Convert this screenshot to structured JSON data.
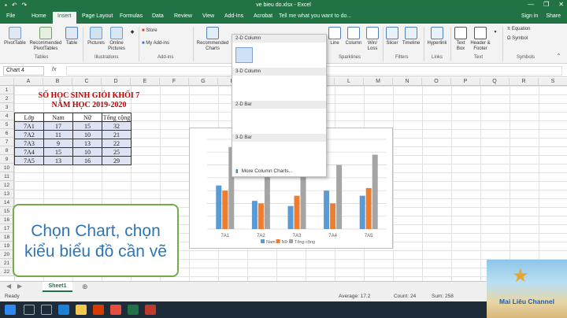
{
  "window": {
    "title": "ve bieu do.xlsx - Excel",
    "minimize": "—",
    "restore": "❐",
    "close": "✕"
  },
  "tabs": [
    "File",
    "Home",
    "Insert",
    "Page Layout",
    "Formulas",
    "Data",
    "Review",
    "View",
    "Add-Ins",
    "Acrobat"
  ],
  "tellme": "Tell me what you want to do...",
  "rightlinks": {
    "signin": "Sign in",
    "share": "Share"
  },
  "ribbon": {
    "tables": {
      "pivot": "PivotTable",
      "recommended": "Recommended PivotTables",
      "table": "Table",
      "group": "Tables"
    },
    "illustrations": {
      "pictures": "Pictures",
      "online": "Online Pictures",
      "group": "Illustrations"
    },
    "addins": {
      "store": "Store",
      "myaddins": "My Add-ins",
      "group": "Add-ins"
    },
    "charts": {
      "recommended": "Recommended Charts"
    },
    "sparklines": {
      "line": "Line",
      "column": "Column",
      "winloss": "Win/ Loss",
      "group": "Sparklines"
    },
    "filters": {
      "slicer": "Slicer",
      "timeline": "Timeline",
      "group": "Filters"
    },
    "links": {
      "hyperlink": "Hyperlink",
      "group": "Links"
    },
    "text": {
      "textbox": "Text Box",
      "header": "Header & Footer",
      "group": "Text"
    },
    "symbols": {
      "equation": "Equation",
      "symbol": "Symbol",
      "group": "Symbols"
    }
  },
  "namebox": "Chart 4",
  "fx": "fx",
  "columns": [
    "A",
    "B",
    "C",
    "D",
    "E",
    "F",
    "G",
    "H",
    "I",
    "J",
    "K",
    "L",
    "M",
    "N",
    "O",
    "P",
    "Q",
    "R",
    "S"
  ],
  "rows": [
    "1",
    "2",
    "3",
    "4",
    "5",
    "6",
    "7",
    "8",
    "9",
    "10",
    "11",
    "12",
    "13",
    "14",
    "15",
    "16",
    "17",
    "18",
    "19",
    "20",
    "21",
    "22"
  ],
  "sheet_title_1": "SỐ HỌC SINH GIỎI KHỐI 7",
  "sheet_title_2": "NĂM HỌC 2019-2020",
  "table": {
    "headers": [
      "Lớp",
      "Nam",
      "Nữ",
      "Tổng cộng"
    ],
    "rows": [
      [
        "7A1",
        "17",
        "15",
        "32"
      ],
      [
        "7A2",
        "11",
        "10",
        "21"
      ],
      [
        "7A3",
        "9",
        "13",
        "22"
      ],
      [
        "7A4",
        "15",
        "10",
        "25"
      ],
      [
        "7A5",
        "13",
        "16",
        "29"
      ]
    ]
  },
  "dropdown": {
    "h2dcol": "2-D Column",
    "h3dcol": "3-D Column",
    "h2dbar": "2-D Bar",
    "h3dbar": "3-D Bar",
    "more": "More Column Charts..."
  },
  "callout": {
    "line1": "Chọn Chart, chọn",
    "line2": "kiểu biểu đồ cần vẽ"
  },
  "sheet_tab": "Sheet1",
  "add_sheet": "⊕",
  "status": {
    "ready": "Ready",
    "average": "Average: 17.2",
    "count": "Count: 24",
    "sum": "Sum: 258"
  },
  "channel": "Mai Liêu Channel",
  "colors": {
    "excel_green": "#217346",
    "nam": "#5b9bd5",
    "nu": "#ed7d31",
    "tong": "#a5a5a5",
    "title_red": "#c00000"
  },
  "chart_data": {
    "type": "bar",
    "categories": [
      "7A1",
      "7A2",
      "7A3",
      "7A4",
      "7A5"
    ],
    "series": [
      {
        "name": "Nam",
        "values": [
          17,
          11,
          9,
          15,
          13
        ],
        "color": "#5b9bd5"
      },
      {
        "name": "Nữ",
        "values": [
          15,
          10,
          13,
          10,
          16
        ],
        "color": "#ed7d31"
      },
      {
        "name": "Tổng cộng",
        "values": [
          32,
          21,
          22,
          25,
          29
        ],
        "color": "#a5a5a5"
      }
    ],
    "ylim": [
      0,
      35
    ],
    "legend": "bottom",
    "grid": true
  }
}
